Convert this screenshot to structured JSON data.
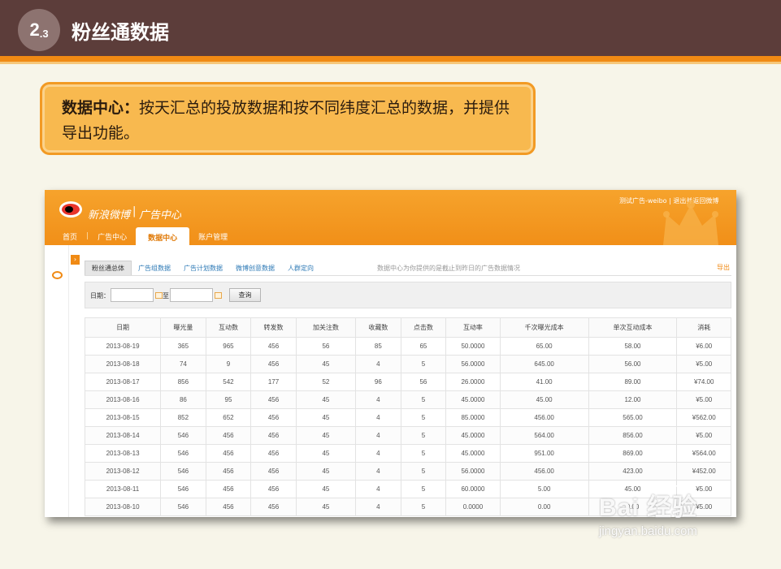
{
  "slide": {
    "section_number": "2",
    "section_sub": ".3",
    "title": "粉丝通数据"
  },
  "note": {
    "label": "数据中心：",
    "text": "按天汇总的投放数据和按不同纬度汇总的数据，并提供导出功能。"
  },
  "app": {
    "brand": "新浪微博",
    "separator": "|",
    "product": "广告中心",
    "user_links": "测试广告-weibo  |  退出并返回微博",
    "nav": {
      "home": "首页",
      "sep": "|",
      "ad_center": "广告中心",
      "data_center": "数据中心",
      "account": "账户管理"
    },
    "sub_tabs": [
      "粉丝通总体",
      "广告组数据",
      "广告计划数据",
      "微博创意数据",
      "人群定向"
    ],
    "sub_note": "数据中心为你提供的是截止到昨日的广告数据情况",
    "export": "导出",
    "filter": {
      "date_label": "日期：",
      "to_label": "至",
      "query_button": "查询"
    },
    "table": {
      "headers": [
        "日期",
        "曝光量",
        "互动数",
        "转发数",
        "加关注数",
        "收藏数",
        "点击数",
        "互动率",
        "千次曝光成本",
        "单次互动成本",
        "消耗"
      ],
      "rows": [
        [
          "2013-08-19",
          "365",
          "965",
          "456",
          "56",
          "85",
          "65",
          "50.0000",
          "65.00",
          "58.00",
          "¥6.00"
        ],
        [
          "2013-08-18",
          "74",
          "9",
          "456",
          "45",
          "4",
          "5",
          "56.0000",
          "645.00",
          "56.00",
          "¥5.00"
        ],
        [
          "2013-08-17",
          "856",
          "542",
          "177",
          "52",
          "96",
          "56",
          "26.0000",
          "41.00",
          "89.00",
          "¥74.00"
        ],
        [
          "2013-08-16",
          "86",
          "95",
          "456",
          "45",
          "4",
          "5",
          "45.0000",
          "45.00",
          "12.00",
          "¥5.00"
        ],
        [
          "2013-08-15",
          "852",
          "652",
          "456",
          "45",
          "4",
          "5",
          "85.0000",
          "456.00",
          "565.00",
          "¥562.00"
        ],
        [
          "2013-08-14",
          "546",
          "456",
          "456",
          "45",
          "4",
          "5",
          "45.0000",
          "564.00",
          "856.00",
          "¥5.00"
        ],
        [
          "2013-08-13",
          "546",
          "456",
          "456",
          "45",
          "4",
          "5",
          "45.0000",
          "951.00",
          "869.00",
          "¥564.00"
        ],
        [
          "2013-08-12",
          "546",
          "456",
          "456",
          "45",
          "4",
          "5",
          "56.0000",
          "456.00",
          "423.00",
          "¥452.00"
        ],
        [
          "2013-08-11",
          "546",
          "456",
          "456",
          "45",
          "4",
          "5",
          "60.0000",
          "5.00",
          "45.00",
          "¥5.00"
        ],
        [
          "2013-08-10",
          "546",
          "456",
          "456",
          "45",
          "4",
          "5",
          "0.0000",
          "0.00",
          "0.00",
          "¥5.00"
        ]
      ]
    }
  },
  "watermark": {
    "main": "Bai 经验",
    "sub": "jingyan.baidu.com"
  },
  "colors": {
    "header_brown": "#5c3d3a",
    "accent_orange": "#f08a14",
    "note_fill": "#f8b94f"
  }
}
